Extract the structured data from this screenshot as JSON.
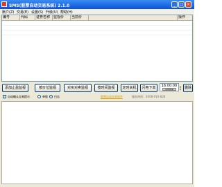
{
  "window": {
    "title": "SMS(股票自动交易系统) 2.1.0",
    "controls": {
      "minimize": "_",
      "maximize": "□",
      "close": "×"
    }
  },
  "menu": [
    {
      "label": "账户(Z)"
    },
    {
      "label": "交易(E)"
    },
    {
      "label": "设置(S)"
    },
    {
      "label": "升级(U)"
    },
    {
      "label": "帮助(H)"
    }
  ],
  "grid": {
    "columns": [
      "编号",
      "代码",
      "证券名称",
      "监视价",
      "当前价",
      "操作"
    ]
  },
  "buttons": {
    "add_watch": "添加止盈监视",
    "stop_loss": "按价位监视",
    "time_watch": "对买对卖监视",
    "ratio_watch": "按时间监视",
    "timed_shutdown": "定时关机",
    "flash_order": "闪电下单",
    "delete": "删除"
  },
  "clock": {
    "time": "16:00:00",
    "button": "设置时间"
  },
  "options": {
    "auto_trade": "自动确认交易提示",
    "radio_1": "单股",
    "radio_2": "日志",
    "auto_trade_checked": true,
    "selected_radio": 2
  },
  "footer": {
    "link": "股票自动交易软件",
    "service": "服务热线：4008-010-828"
  }
}
